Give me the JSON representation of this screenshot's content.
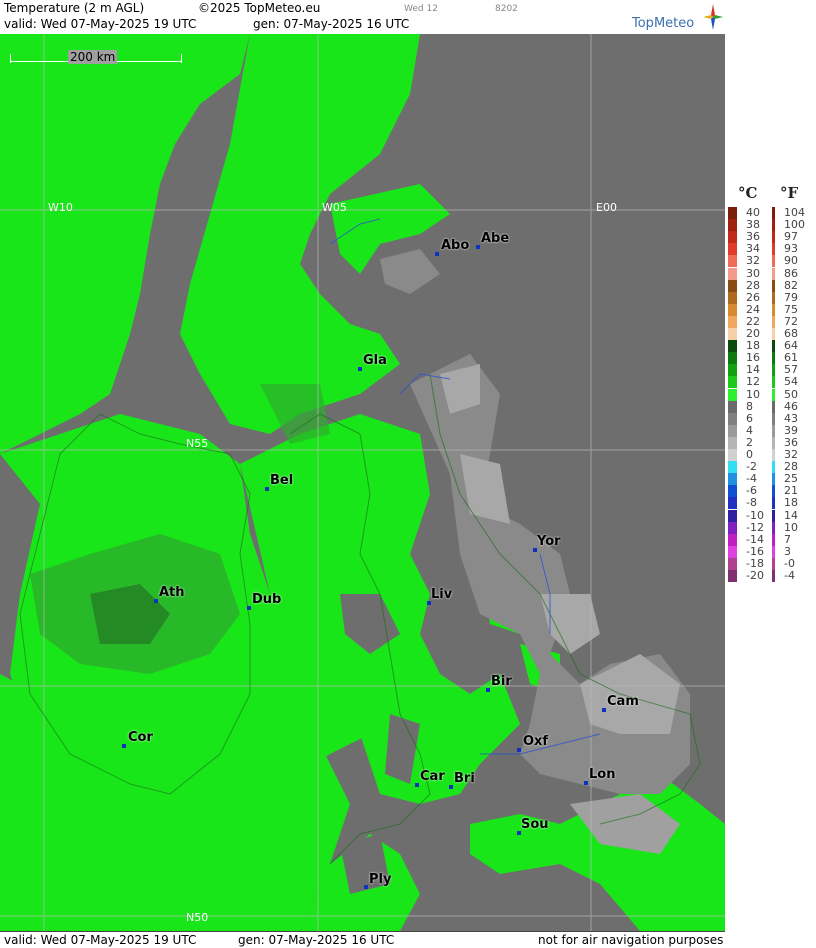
{
  "header": {
    "title": "Temperature (2 m AGL)",
    "copyright": "©2025 TopMeteo.eu",
    "run_label": "Wed 12",
    "code": "8202",
    "valid": "valid:  Wed  07-May-2025  19 UTC",
    "gen": "gen: 07-May-2025 16 UTC",
    "logo": "TopMeteo"
  },
  "footer": {
    "valid": "valid:  Wed  07-May-2025  19 UTC",
    "gen": "gen: 07-May-2025 16 UTC",
    "disclaimer": "not for air navigation purposes"
  },
  "map": {
    "scale_label": "200 km",
    "grid_labels": {
      "w10": "W10",
      "w05": "W05",
      "e00": "E00",
      "n55": "N55",
      "n50": "N50"
    },
    "cities": [
      {
        "name": "Abo"
      },
      {
        "name": "Abe"
      },
      {
        "name": "Gla"
      },
      {
        "name": "Bel"
      },
      {
        "name": "Yor"
      },
      {
        "name": "Ath"
      },
      {
        "name": "Dub"
      },
      {
        "name": "Liv"
      },
      {
        "name": "Bir"
      },
      {
        "name": "Cam"
      },
      {
        "name": "Cor"
      },
      {
        "name": "Oxf"
      },
      {
        "name": "Lon"
      },
      {
        "name": "Car"
      },
      {
        "name": "Bri"
      },
      {
        "name": "Sou"
      },
      {
        "name": "Ply"
      }
    ],
    "colors": {
      "sea": "#6e6e6e",
      "land_green": "#19e619",
      "dark_green": "#2cae2c",
      "grey_land": "#8a8a8a",
      "light_grey": "#a8a8a8"
    }
  },
  "legend": {
    "celsius_unit": "°C",
    "fahrenheit_unit": "°F",
    "celsius": [
      "40",
      "38",
      "36",
      "34",
      "32",
      "30",
      "28",
      "26",
      "24",
      "22",
      "20",
      "18",
      "16",
      "14",
      "12",
      "10",
      "8",
      "6",
      "4",
      "2",
      "0",
      "-2",
      "-4",
      "-6",
      "-8",
      "-10",
      "-12",
      "-14",
      "-16",
      "-18",
      "-20"
    ],
    "fahrenheit": [
      "104",
      "100",
      "97",
      "93",
      "90",
      "86",
      "82",
      "79",
      "75",
      "72",
      "68",
      "64",
      "61",
      "57",
      "54",
      "50",
      "46",
      "43",
      "39",
      "36",
      "32",
      "28",
      "25",
      "21",
      "18",
      "14",
      "10",
      "7",
      "3",
      "-0",
      "-4"
    ],
    "colors": [
      "#7a1e0a",
      "#a02010",
      "#c02818",
      "#e03a28",
      "#f06a5a",
      "#f49a8a",
      "#8a4a14",
      "#b06a20",
      "#d88a30",
      "#f0a860",
      "#f6d0a8",
      "#0a4a0a",
      "#0c7a0c",
      "#10a010",
      "#1cc81c",
      "#2ef02e",
      "#6a6a6a",
      "#808080",
      "#9a9a9a",
      "#b4b4b4",
      "#d0d0d0",
      "#30e0f0",
      "#2090e0",
      "#1050d0",
      "#2030c0",
      "#3020a0",
      "#8020c0",
      "#c020c0",
      "#e040e0",
      "#b04090",
      "#803070"
    ]
  }
}
